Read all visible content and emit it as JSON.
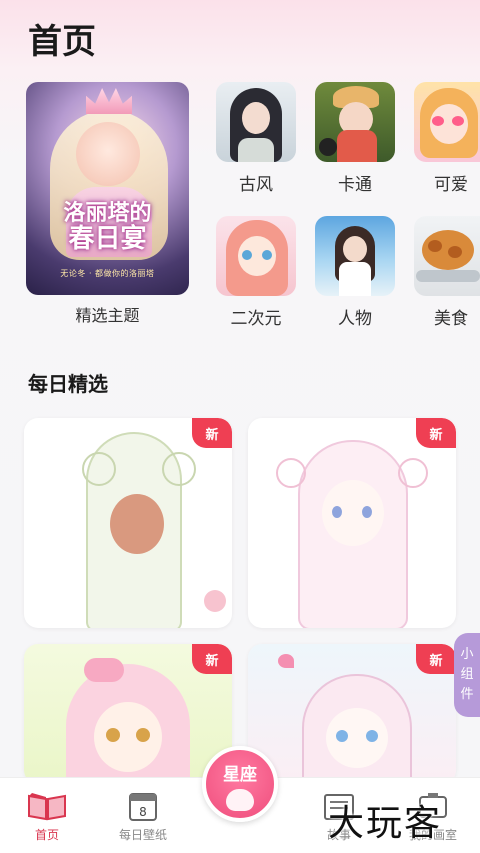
{
  "header": {
    "title": "首页"
  },
  "featured": {
    "label": "精选主题",
    "poster_line1": "洛丽塔的",
    "poster_line2": "春日宴",
    "poster_sub": "无论冬 · 都做你的洛丽塔"
  },
  "categories": [
    {
      "label": "古风",
      "icon": "ancient-style-thumbnail"
    },
    {
      "label": "卡通",
      "icon": "cartoon-thumbnail"
    },
    {
      "label": "可爱",
      "icon": "cute-thumbnail"
    },
    {
      "label": "二次元",
      "icon": "anime-thumbnail"
    },
    {
      "label": "人物",
      "icon": "character-thumbnail"
    },
    {
      "label": "美食",
      "icon": "food-thumbnail"
    }
  ],
  "daily": {
    "title": "每日精选",
    "cards": [
      {
        "badge": "新"
      },
      {
        "badge": "新"
      },
      {
        "badge": "新"
      },
      {
        "badge": "新"
      }
    ]
  },
  "widget_tab": {
    "label_1": "小",
    "label_2": "组",
    "label_3": "件"
  },
  "tabbar": {
    "items": [
      {
        "label": "首页",
        "icon": "book-icon",
        "active": true
      },
      {
        "label": "每日壁纸",
        "icon": "calendar-icon",
        "active": false
      },
      {
        "label": "故事",
        "icon": "story-icon",
        "active": false
      },
      {
        "label": "我的画室",
        "icon": "studio-icon",
        "active": false
      }
    ],
    "center_label": "星座"
  },
  "watermark": "大玩客",
  "colors": {
    "accent": "#ef3f53",
    "active_tab": "#d9364f",
    "widget": "#b69ad9"
  }
}
